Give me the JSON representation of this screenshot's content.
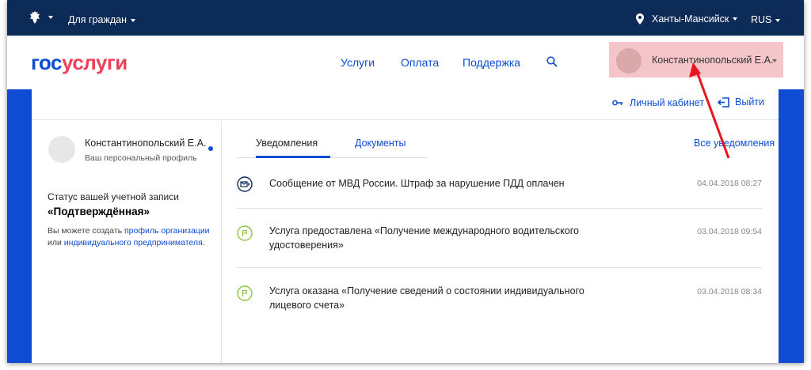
{
  "topbar": {
    "emblem_icon": "coat-of-arms-icon",
    "audience_label": "Для граждан",
    "region_label": "Ханты-Мансийск",
    "language_label": "RUS"
  },
  "header": {
    "logo_part1": "гос",
    "logo_part2": "услуги",
    "nav": [
      "Услуги",
      "Оплата",
      "Поддержка"
    ],
    "user_name": "Константинопольский Е.А."
  },
  "card": {
    "personal_cabinet": "Личный кабинет",
    "logout": "Выйти"
  },
  "sidebar": {
    "user_name": "Константинопольский Е.А.",
    "profile_label": "Ваш персональный профиль",
    "status_label": "Статус вашей учетной записи",
    "status_value": "«Подтверждённая»",
    "hint_prefix": "Вы можете создать ",
    "hint_link1": "профиль организации",
    "hint_middle": " или ",
    "hint_link2": "индивидуального предпринимателя",
    "hint_suffix": "."
  },
  "main": {
    "tabs": [
      "Уведомления",
      "Документы"
    ],
    "all_notifications": "Все уведомления",
    "notifications": [
      {
        "text": "Сообщение от МВД России. Штраф за нарушение ПДД оплачен",
        "date": "04.04.2018 08:27",
        "icon": "mail-reply-icon"
      },
      {
        "text": "Услуга предоставлена «Получение международного водительского удостоверения»",
        "date": "03.04.2018 09:54",
        "icon": "flag-circle-icon"
      },
      {
        "text": "Услуга оказана «Получение сведений о состоянии индивидуального лицевого счета»",
        "date": "03.04.2018 08:34",
        "icon": "flag-circle-icon"
      }
    ]
  },
  "colors": {
    "topbar": "#0d2b57",
    "brand_blue": "#0d4cd3",
    "brand_red": "#ee3f58",
    "highlight": "#f5c6c9",
    "annotation_arrow": "#e8141e",
    "success_green": "#8dc63f"
  }
}
